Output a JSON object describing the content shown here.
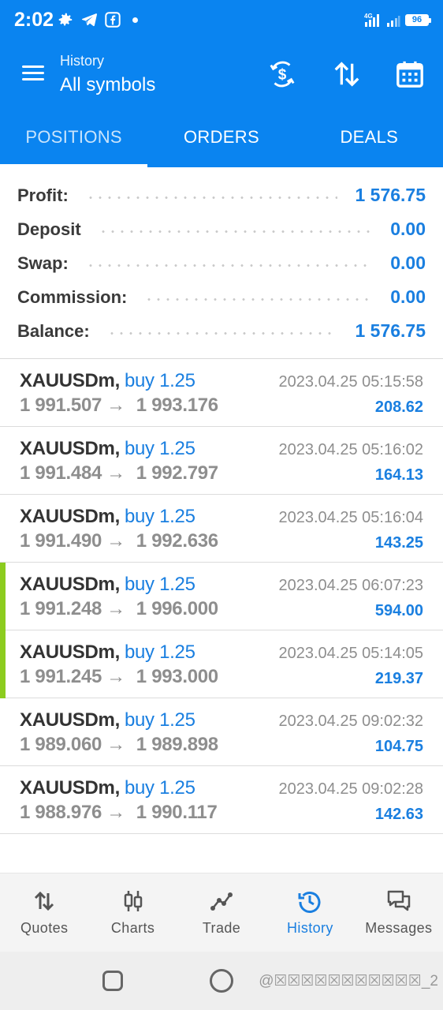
{
  "status_bar": {
    "time": "2:02",
    "network": "4G",
    "battery": "96"
  },
  "header": {
    "subtitle": "History",
    "title": "All symbols"
  },
  "tabs": [
    {
      "label": "POSITIONS",
      "active": true
    },
    {
      "label": "ORDERS",
      "active": false
    },
    {
      "label": "DEALS",
      "active": false
    }
  ],
  "summary": [
    {
      "label": "Profit:",
      "value": "1 576.75"
    },
    {
      "label": "Deposit",
      "value": "0.00"
    },
    {
      "label": "Swap:",
      "value": "0.00"
    },
    {
      "label": "Commission:",
      "value": "0.00"
    },
    {
      "label": "Balance:",
      "value": "1 576.75"
    }
  ],
  "deals": [
    {
      "symbol": "XAUUSDm,",
      "type": "buy 1.25",
      "open": "1 991.507",
      "arrow": "→",
      "close": "1 993.176",
      "time": "2023.04.25 05:15:58",
      "profit": "208.62",
      "marked": false
    },
    {
      "symbol": "XAUUSDm,",
      "type": "buy 1.25",
      "open": "1 991.484",
      "arrow": "→",
      "close": "1 992.797",
      "time": "2023.04.25 05:16:02",
      "profit": "164.13",
      "marked": false
    },
    {
      "symbol": "XAUUSDm,",
      "type": "buy 1.25",
      "open": "1 991.490",
      "arrow": "→",
      "close": "1 992.636",
      "time": "2023.04.25 05:16:04",
      "profit": "143.25",
      "marked": false
    },
    {
      "symbol": "XAUUSDm,",
      "type": "buy 1.25",
      "open": "1 991.248",
      "arrow": "→",
      "close": "1 996.000",
      "time": "2023.04.25 06:07:23",
      "profit": "594.00",
      "marked": true
    },
    {
      "symbol": "XAUUSDm,",
      "type": "buy 1.25",
      "open": "1 991.245",
      "arrow": "→",
      "close": "1 993.000",
      "time": "2023.04.25 05:14:05",
      "profit": "219.37",
      "marked": true
    },
    {
      "symbol": "XAUUSDm,",
      "type": "buy 1.25",
      "open": "1 989.060",
      "arrow": "→",
      "close": "1 989.898",
      "time": "2023.04.25 09:02:32",
      "profit": "104.75",
      "marked": false
    },
    {
      "symbol": "XAUUSDm,",
      "type": "buy 1.25",
      "open": "1 988.976",
      "arrow": "→",
      "close": "1 990.117",
      "time": "2023.04.25 09:02:28",
      "profit": "142.63",
      "marked": false
    }
  ],
  "bottom_nav": [
    {
      "label": "Quotes",
      "icon": "quotes-icon",
      "active": false
    },
    {
      "label": "Charts",
      "icon": "charts-icon",
      "active": false
    },
    {
      "label": "Trade",
      "icon": "trade-icon",
      "active": false
    },
    {
      "label": "History",
      "icon": "history-icon",
      "active": true
    },
    {
      "label": "Messages",
      "icon": "messages-icon",
      "active": false
    }
  ],
  "colors": {
    "brand_blue": "#0a84f0",
    "value_blue": "#1a7fe0",
    "marker_green": "#8ccc1f"
  },
  "watermark": "@☒☒☒☒☒☒☒☒☒☒☒_2"
}
